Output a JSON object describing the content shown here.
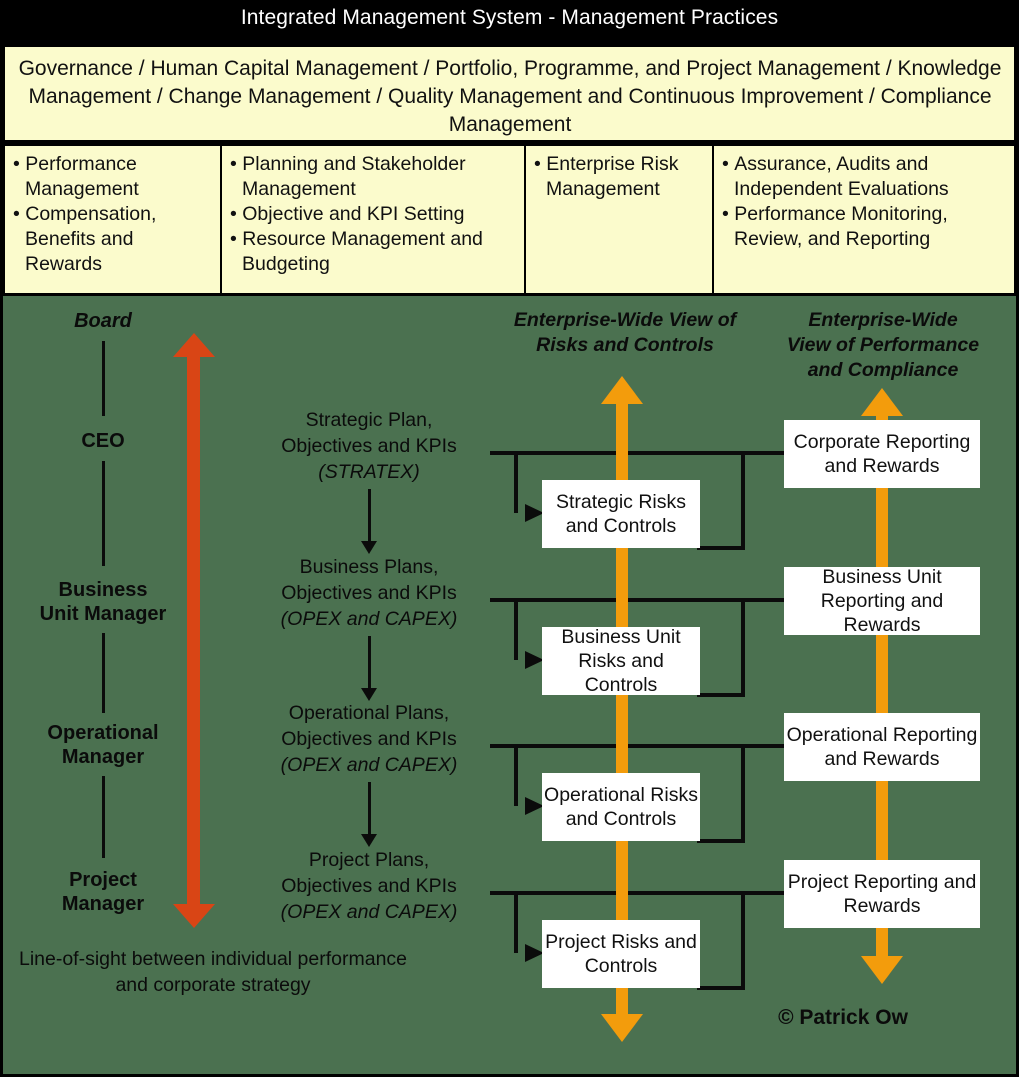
{
  "header": {
    "title": "Integrated Management System - Management Practices"
  },
  "practices": {
    "text": "Governance / Human Capital Management / Portfolio, Programme, and Project Management / Knowledge Management / Change Management / Quality Management and Continuous Improvement / Compliance Management"
  },
  "columns": [
    {
      "items": [
        "Performance Management",
        "Compensation, Benefits and Rewards"
      ]
    },
    {
      "items": [
        "Planning and Stakeholder Management",
        "Objective and KPI Setting",
        "Resource Management and Budgeting"
      ]
    },
    {
      "items": [
        "Enterprise Risk Management"
      ]
    },
    {
      "items": [
        "Assurance, Audits and Independent Evaluations",
        "Performance Monitoring, Review, and Reporting"
      ]
    }
  ],
  "diagram": {
    "org_levels": [
      {
        "label": "Board",
        "style": "italic"
      },
      {
        "label": "CEO",
        "style": "bold"
      },
      {
        "label": "Business\nUnit Manager",
        "style": "bold"
      },
      {
        "label": "Operational\nManager",
        "style": "bold"
      },
      {
        "label": "Project\nManager",
        "style": "bold"
      }
    ],
    "org_level_0": "Board",
    "org_level_1": "CEO",
    "org_level_2_line1": "Business",
    "org_level_2_line2": "Unit Manager",
    "org_level_3_line1": "Operational",
    "org_level_3_line2": "Manager",
    "org_level_4_line1": "Project",
    "org_level_4_line2": "Manager",
    "line_of_sight": "Line-of-sight between individual performance and corporate strategy",
    "risks_heading": "Enterprise-Wide View of Risks and Controls",
    "risks_heading_line1": "Enterprise-Wide View of",
    "risks_heading_line2": "Risks and Controls",
    "performance_heading": "Enterprise-Wide View of Performance and Compliance",
    "performance_heading_line1": "Enterprise-Wide",
    "performance_heading_line2": "View of Performance",
    "performance_heading_line3": "and Compliance",
    "plans": [
      {
        "line1": "Strategic Plan,",
        "line2": "Objectives and KPIs",
        "sub": "(STRATEX)"
      },
      {
        "line1": "Business Plans,",
        "line2": "Objectives and KPIs",
        "sub": "(OPEX and CAPEX)"
      },
      {
        "line1": "Operational Plans,",
        "line2": "Objectives and KPIs",
        "sub": "(OPEX and CAPEX)"
      },
      {
        "line1": "Project Plans,",
        "line2": "Objectives and KPIs",
        "sub": "(OPEX and CAPEX)"
      }
    ],
    "risk_boxes": [
      {
        "text": "Strategic Risks and Controls"
      },
      {
        "text": "Business Unit Risks and Controls"
      },
      {
        "text": "Operational Risks and Controls"
      },
      {
        "text": "Project Risks and Controls"
      }
    ],
    "reporting_boxes": [
      {
        "text": "Corporate Reporting and Rewards"
      },
      {
        "text": "Business Unit Reporting and Rewards"
      },
      {
        "text": "Operational Reporting and Rewards"
      },
      {
        "text": "Project Reporting and Rewards"
      }
    ],
    "copyright": "© Patrick Ow"
  },
  "colors": {
    "header_bg": "#000000",
    "panel_bg": "#FBFBCC",
    "canvas_bg": "#4B7150",
    "red_arrow": "#D94515",
    "orange_arrow": "#F39C0C",
    "box_bg": "#FFFFFF",
    "line": "#0B0B0B"
  }
}
